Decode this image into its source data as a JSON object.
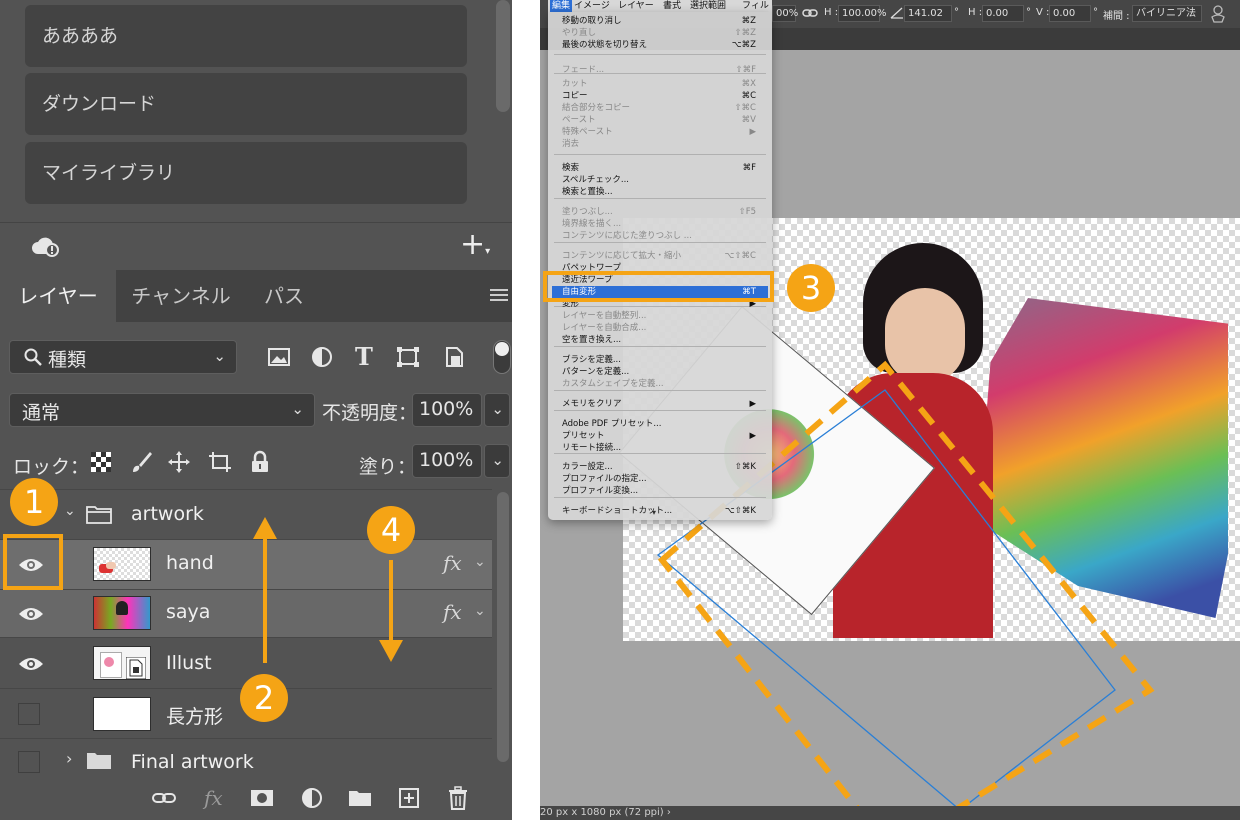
{
  "libraries": {
    "items": [
      "ああああ",
      "ダウンロード",
      "マイライブラリ"
    ]
  },
  "layers_panel": {
    "tabs": [
      "レイヤー",
      "チャンネル",
      "パス"
    ],
    "filter_value": "種類",
    "blend_mode": "通常",
    "opacity_label": "不透明度：",
    "opacity_value": "100%",
    "lock_label": "ロック：",
    "fill_label": "塗り：",
    "fill_value": "100%",
    "layers": [
      {
        "name": "artwork",
        "type": "group",
        "expanded": true
      },
      {
        "name": "hand",
        "visible": true,
        "fx": "fx"
      },
      {
        "name": "saya",
        "visible": true,
        "fx": "fx"
      },
      {
        "name": "Illust",
        "visible": true
      },
      {
        "name": "長方形",
        "visible": false
      },
      {
        "name": "Final artwork",
        "type": "group",
        "expanded": false
      }
    ]
  },
  "annotations": {
    "markers": [
      "1",
      "2",
      "3",
      "4"
    ],
    "color": "#f5a415"
  },
  "options_bar": {
    "w_value": "00%",
    "h_label": "H :",
    "h_value": "100.00%",
    "angle_value": "141.02",
    "deg": "°",
    "hskew_label": "H :",
    "hskew_value": "0.00",
    "vskew_label": "V :",
    "vskew_value": "0.00",
    "interp_label": "補間 :",
    "interp_value": "バイリニア法"
  },
  "menubar": [
    "編集",
    "イメージ",
    "レイヤー",
    "書式",
    "選択範囲",
    "フィル"
  ],
  "edit_menu": {
    "items": [
      {
        "label": "移動の取り消し",
        "shortcut": "⌘Z",
        "enabled": true
      },
      {
        "label": "やり直し",
        "shortcut": "⇧⌘Z",
        "enabled": false
      },
      {
        "label": "最後の状態を切り替え",
        "shortcut": "⌥⌘Z",
        "enabled": true
      },
      {
        "label": "フェード...",
        "shortcut": "⇧⌘F",
        "enabled": false
      },
      {
        "label": "カット",
        "shortcut": "⌘X",
        "enabled": false
      },
      {
        "label": "コピー",
        "shortcut": "⌘C",
        "enabled": true
      },
      {
        "label": "結合部分をコピー",
        "shortcut": "⇧⌘C",
        "enabled": false
      },
      {
        "label": "ペースト",
        "shortcut": "⌘V",
        "enabled": false
      },
      {
        "label": "特殊ペースト",
        "shortcut": "▶",
        "enabled": false
      },
      {
        "label": "消去",
        "shortcut": "",
        "enabled": false
      },
      {
        "label": "検索",
        "shortcut": "⌘F",
        "enabled": true
      },
      {
        "label": "スペルチェック...",
        "shortcut": "",
        "enabled": true
      },
      {
        "label": "検索と置換...",
        "shortcut": "",
        "enabled": true
      },
      {
        "label": "塗りつぶし...",
        "shortcut": "⇧F5",
        "enabled": false
      },
      {
        "label": "境界線を描く...",
        "shortcut": "",
        "enabled": false
      },
      {
        "label": "コンテンツに応じた塗りつぶし ...",
        "shortcut": "",
        "enabled": false
      },
      {
        "label": "コンテンツに応じて拡大・縮小",
        "shortcut": "⌥⇧⌘C",
        "enabled": false
      },
      {
        "label": "パペットワープ",
        "shortcut": "",
        "enabled": true
      },
      {
        "label": "遠近法ワープ",
        "shortcut": "",
        "enabled": true
      },
      {
        "label": "自由変形",
        "shortcut": "⌘T",
        "enabled": true,
        "highlighted": true
      },
      {
        "label": "変形",
        "shortcut": "▶",
        "enabled": true
      },
      {
        "label": "レイヤーを自動整列...",
        "shortcut": "",
        "enabled": false
      },
      {
        "label": "レイヤーを自動合成...",
        "shortcut": "",
        "enabled": false
      },
      {
        "label": "空を置き換え...",
        "shortcut": "",
        "enabled": true
      },
      {
        "label": "ブラシを定義...",
        "shortcut": "",
        "enabled": true
      },
      {
        "label": "パターンを定義...",
        "shortcut": "",
        "enabled": true
      },
      {
        "label": "カスタムシェイプを定義...",
        "shortcut": "",
        "enabled": false
      },
      {
        "label": "メモリをクリア",
        "shortcut": "▶",
        "enabled": true
      },
      {
        "label": "Adobe PDF プリセット...",
        "shortcut": "",
        "enabled": true
      },
      {
        "label": "プリセット",
        "shortcut": "▶",
        "enabled": true
      },
      {
        "label": "リモート接続...",
        "shortcut": "",
        "enabled": true
      },
      {
        "label": "カラー設定...",
        "shortcut": "⇧⌘K",
        "enabled": true
      },
      {
        "label": "プロファイルの指定...",
        "shortcut": "",
        "enabled": true
      },
      {
        "label": "プロファイル変換...",
        "shortcut": "",
        "enabled": true
      },
      {
        "label": "キーボードショートカット...",
        "shortcut": "⌥⇧⌘K",
        "enabled": true
      }
    ]
  },
  "status_bar": {
    "doc_size": "20 px x 1080 px (72 ppi)"
  }
}
